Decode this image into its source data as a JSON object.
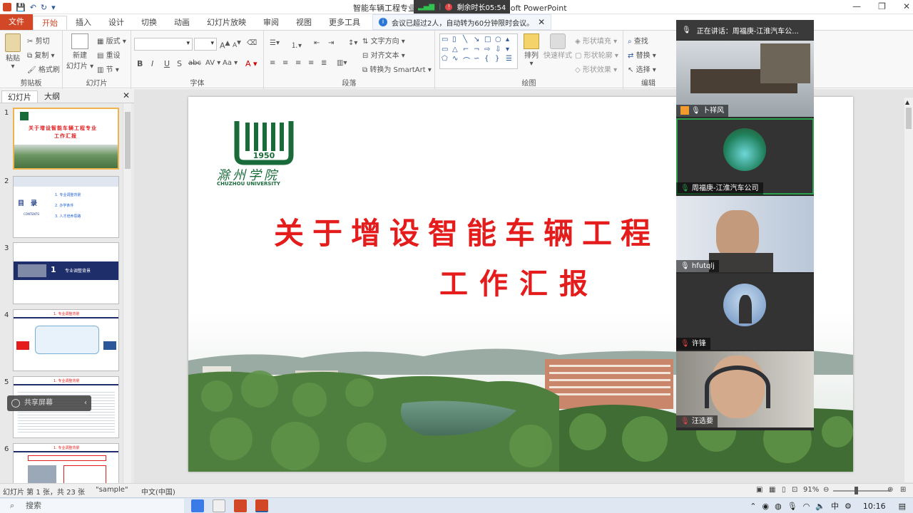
{
  "window": {
    "title_left": "智能车辆工程专业增",
    "title_right": "rosoft PowerPoint",
    "controls": {
      "minimize": "—",
      "restore": "❐",
      "close": "✕"
    }
  },
  "meeting": {
    "remaining_time": "剩余时长05:54",
    "notice": "会议已超过2人，自动转为60分钟限时会议。",
    "current_speaker": "正在讲话：周福庚-江淮汽车公...",
    "participants": [
      {
        "name": "卜祥风"
      },
      {
        "name": "周福庚-江淮汽车公司"
      },
      {
        "name": "hfutqlj"
      },
      {
        "name": "许锋"
      },
      {
        "name": "汪选要"
      }
    ]
  },
  "ribbon": {
    "tabs": [
      "文件",
      "开始",
      "插入",
      "设计",
      "切换",
      "动画",
      "幻灯片放映",
      "审阅",
      "视图",
      "更多工具"
    ],
    "active_tab": "开始",
    "clipboard": {
      "paste": "粘贴",
      "cut": "剪切",
      "copy": "复制",
      "format_painter": "格式刷",
      "label": "剪贴板"
    },
    "slides": {
      "new_slide": "新建",
      "new_slide2": "幻灯片",
      "layout": "版式",
      "reset": "重设",
      "section": "节",
      "label": "幻灯片"
    },
    "font": {
      "bold": "B",
      "italic": "I",
      "underline": "U",
      "shadow": "S",
      "strike": "abc",
      "spacing": "AV",
      "case": "Aa",
      "grow": "A",
      "shrink": "A",
      "color": "A",
      "label": "字体"
    },
    "paragraph": {
      "text_direction": "文字方向",
      "align_text": "对齐文本",
      "convert_smartart": "转换为 SmartArt",
      "label": "段落"
    },
    "drawing": {
      "arrange": "排列",
      "quick_styles": "快速样式",
      "shape_fill": "形状填充",
      "shape_outline": "形状轮廓",
      "shape_effects": "形状效果",
      "label": "绘图"
    },
    "editing": {
      "find": "查找",
      "replace": "替换",
      "select": "选择",
      "label": "编辑"
    }
  },
  "panel": {
    "tab_slides": "幻灯片",
    "tab_outline": "大纲",
    "thumbnails": [
      {
        "num": "1",
        "title": "关于增设智能车辆工程专业",
        "subtitle": "工作汇报"
      },
      {
        "num": "2",
        "heading": "目　录",
        "sub": "CONTENTS",
        "items": [
          "1. 专业调整背景",
          "2. 办学条件",
          "3. 人才培养思路"
        ]
      },
      {
        "num": "3",
        "heading": "1",
        "text": "专业调整背景"
      },
      {
        "num": "4",
        "heading": "1. 专业调整背景"
      },
      {
        "num": "5",
        "heading": "1. 专业调整背景"
      },
      {
        "num": "6",
        "heading": "1. 专业调整背景"
      }
    ],
    "overlay_label": "共享屏幕"
  },
  "slide": {
    "logo_year": "1950",
    "logo_cn": "滁州学院",
    "logo_en": "CHUZHOU UNIVERSITY",
    "title_line1": "关于增设智能车辆工程",
    "title_line2": "工作汇报"
  },
  "status": {
    "slide_info": "幻灯片 第 1 张，共 23 张",
    "theme": "\"sample\"",
    "language": "中文(中国)",
    "zoom": "91%"
  },
  "taskbar": {
    "search": "搜索",
    "ime": "中",
    "time": "10:16"
  },
  "colors": {
    "accent": "#d24726",
    "title_red": "#e51c1c",
    "logo_green": "#1a6b3a",
    "speaking": "#2ca24f"
  }
}
